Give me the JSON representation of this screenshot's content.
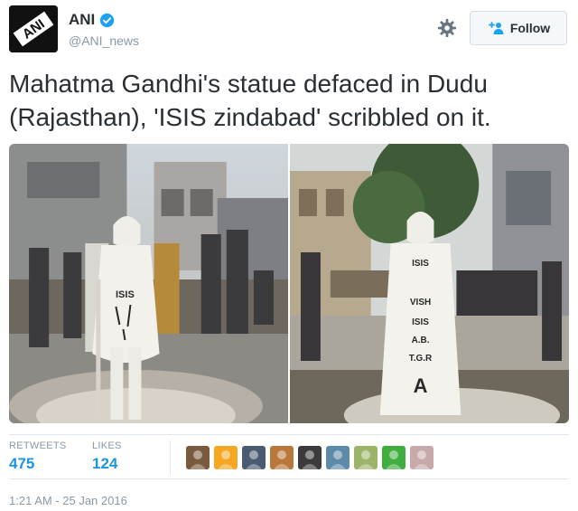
{
  "user": {
    "display_name": "ANI",
    "handle": "@ANI_news",
    "avatar_text": "ANI"
  },
  "actions": {
    "follow_label": "Follow"
  },
  "tweet": {
    "text": "Mahatma Gandhi's statue defaced in Dudu (Rajasthan), 'ISIS zindabad' scribbled on it.",
    "photo_1_graffiti": "ISIS",
    "photo_2_graffiti": [
      "ISIS",
      "VISH",
      "ISIS",
      "A.B.",
      "T.G.R",
      "A"
    ]
  },
  "stats": {
    "retweets_label": "RETWEETS",
    "retweets_value": "475",
    "likes_label": "LIKES",
    "likes_value": "124"
  },
  "likers": [
    {
      "name": "liker-avatar-1",
      "color": "#7a5a3c"
    },
    {
      "name": "liker-avatar-2",
      "color": "#f5a623"
    },
    {
      "name": "liker-avatar-3",
      "color": "#4a5a70"
    },
    {
      "name": "liker-avatar-4",
      "color": "#b9773a"
    },
    {
      "name": "liker-avatar-5",
      "color": "#3b3b3b"
    },
    {
      "name": "liker-avatar-6",
      "color": "#5c8aa8"
    },
    {
      "name": "liker-avatar-7",
      "color": "#9bb46a"
    },
    {
      "name": "liker-avatar-8",
      "color": "#3fae3f"
    },
    {
      "name": "liker-avatar-9",
      "color": "#c7a9a9"
    }
  ],
  "meta": {
    "timestamp": "1:21 AM - 25 Jan 2016"
  },
  "colors": {
    "accent": "#1b95e0",
    "muted": "#8899a6",
    "verified": "#1da1f2"
  }
}
